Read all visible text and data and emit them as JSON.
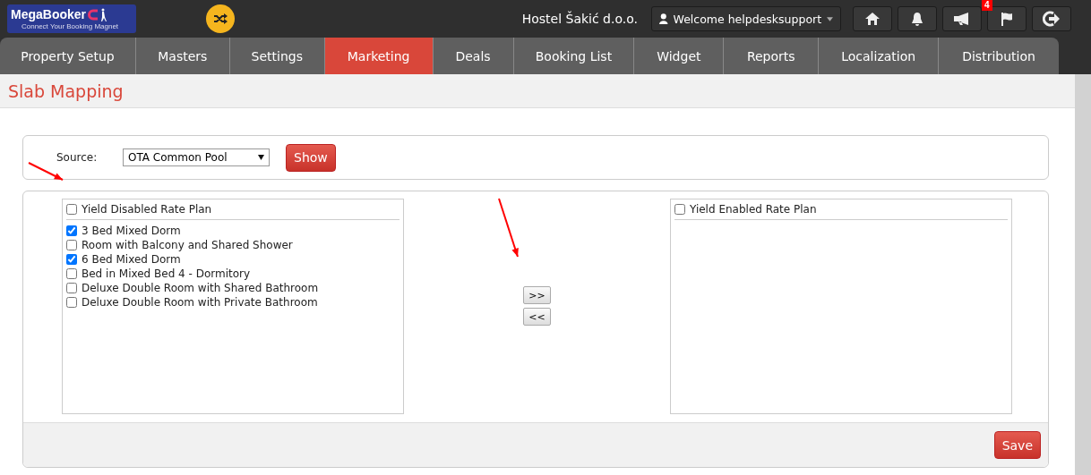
{
  "header": {
    "logo": {
      "name": "MegaBooker",
      "tagline": "Connect Your Booking Magnet"
    },
    "property": "Hostel Šakić d.o.o.",
    "user_menu": "Welcome helpdesksupport",
    "buttons": [
      {
        "kind": "home"
      },
      {
        "kind": "bell"
      },
      {
        "kind": "megaphone"
      },
      {
        "kind": "flag",
        "badge": "4"
      },
      {
        "kind": "logout"
      }
    ]
  },
  "tabs": [
    {
      "label": "Property Setup",
      "selected": false
    },
    {
      "label": "Masters",
      "selected": false
    },
    {
      "label": "Settings",
      "selected": false
    },
    {
      "label": "Marketing",
      "selected": true
    },
    {
      "label": "Deals",
      "selected": false
    },
    {
      "label": "Booking List",
      "selected": false
    },
    {
      "label": "Widget",
      "selected": false
    },
    {
      "label": "Reports",
      "selected": false
    },
    {
      "label": "Localization",
      "selected": false
    },
    {
      "label": "Distribution",
      "selected": false
    }
  ],
  "page_title": "Slab Mapping",
  "source": {
    "label": "Source:",
    "value": "OTA Common Pool",
    "button": "Show"
  },
  "left_list": {
    "header": "Yield Disabled Rate Plan",
    "checked": false,
    "items": [
      {
        "label": "3 Bed Mixed Dorm",
        "checked": true
      },
      {
        "label": "Room with Balcony and Shared Shower",
        "checked": false
      },
      {
        "label": "6 Bed Mixed Dorm",
        "checked": true
      },
      {
        "label": "Bed in Mixed Bed 4 - Dormitory",
        "checked": false
      },
      {
        "label": "Deluxe Double Room with Shared Bathroom",
        "checked": false
      },
      {
        "label": "Deluxe Double Room with Private Bathroom",
        "checked": false
      }
    ]
  },
  "move_buttons": [
    ">>",
    "<<"
  ],
  "right_list": {
    "header": "Yield Enabled Rate Plan",
    "checked": false
  },
  "save_button": "Save"
}
